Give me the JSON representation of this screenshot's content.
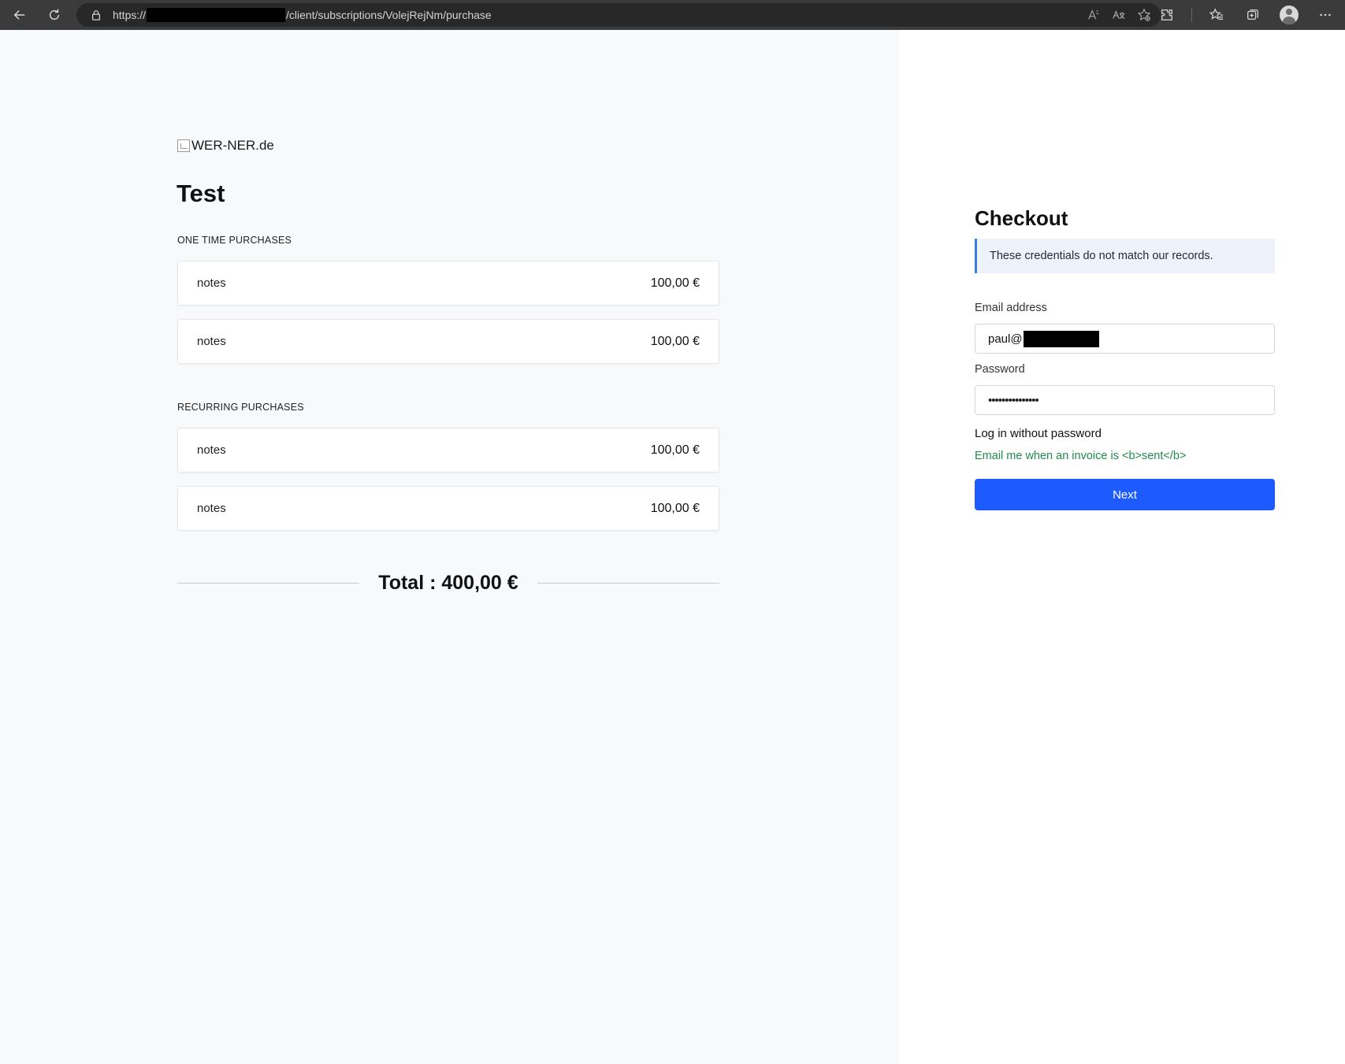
{
  "browser": {
    "url_prefix": "https://",
    "url_path": "/client/subscriptions/VolejRejNm/purchase"
  },
  "store": {
    "logo_alt": "WER-NER.de",
    "title": "Test"
  },
  "one_time": {
    "label": "ONE TIME PURCHASES",
    "items": [
      {
        "name": "notes",
        "price": "100,00 €"
      },
      {
        "name": "notes",
        "price": "100,00 €"
      }
    ]
  },
  "recurring": {
    "label": "RECURRING PURCHASES",
    "items": [
      {
        "name": "notes",
        "price": "100,00 €"
      },
      {
        "name": "notes",
        "price": "100,00 €"
      }
    ]
  },
  "total": {
    "text": "Total : 400,00 €"
  },
  "checkout": {
    "title": "Checkout",
    "alert": "These credentials do not match our records.",
    "email_label": "Email address",
    "email_value": "paul@",
    "password_label": "Password",
    "password_value": "•••••••••••••••",
    "login_without_password": "Log in without password",
    "invoice_email_link": "Email me when an invoice is <b>sent</b>",
    "next_button": "Next"
  },
  "colors": {
    "primary_button": "#1e5bff",
    "link_green": "#1f8b4c",
    "alert_border": "#3b7ddd",
    "left_bg": "#f8f9fb"
  },
  "icons": {
    "browser": [
      "back-icon",
      "reload-icon",
      "lock-icon",
      "read-aloud-icon",
      "translate-icon",
      "add-favorite-icon",
      "extensions-icon",
      "favorites-icon",
      "collections-icon",
      "profile-icon",
      "more-icon"
    ],
    "content": [
      "broken-image-icon"
    ]
  }
}
